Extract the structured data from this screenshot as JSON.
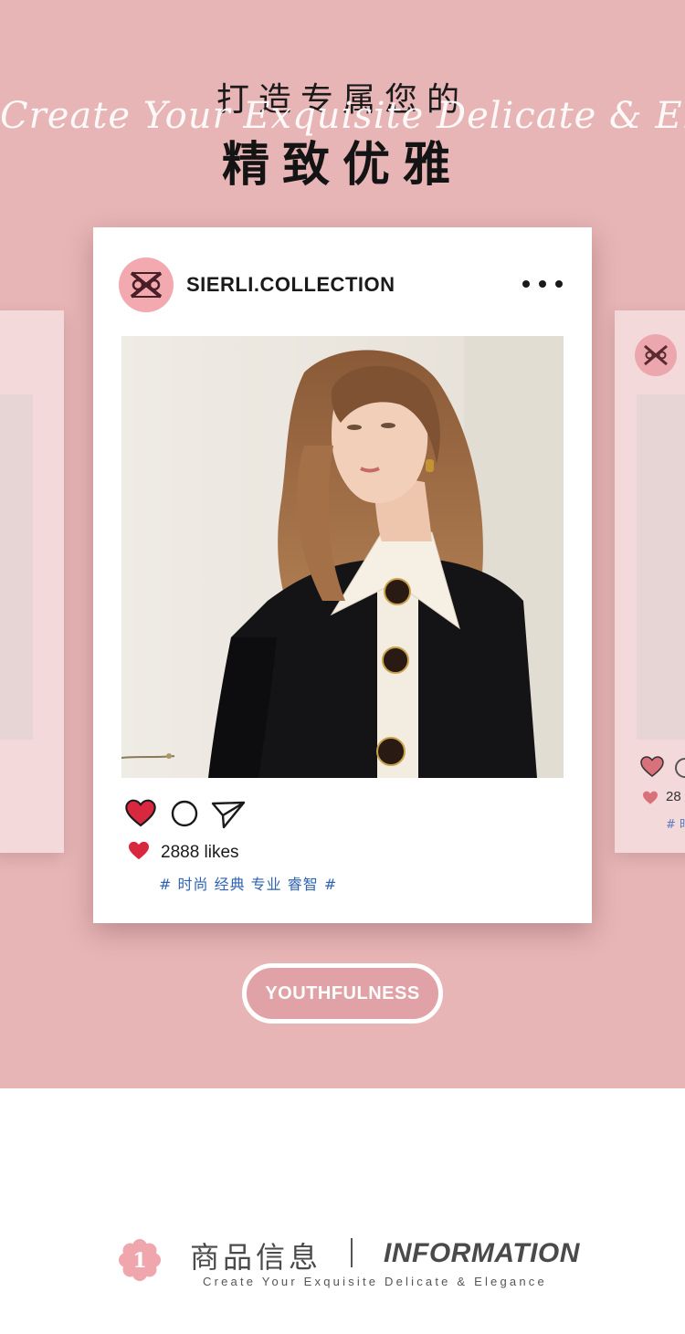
{
  "header": {
    "title_line1": "打造专属您的",
    "script_text": "Create Your Exquisite Delicate & Elegance",
    "title_line2": "精致优雅"
  },
  "post": {
    "handle": "SIERLI.COLLECTION",
    "avatar_icon": "brand-monogram-icon",
    "more_icon": "more-dots-icon",
    "actions": [
      "heart-icon",
      "comment-icon",
      "share-icon"
    ],
    "likes_text": "2888 likes",
    "tags": "# 时尚 经典 专业 睿智 #"
  },
  "ghost_card": {
    "likes_text": "28",
    "tag_text": "# 时"
  },
  "badge": {
    "label": "YOUTHFULNESS"
  },
  "info": {
    "number": "1",
    "title_cn": "商品信息",
    "separator": "|",
    "title_en": "INFORMATION",
    "subtitle": "Create Your Exquisite Delicate & Elegance"
  },
  "colors": {
    "hero_bg": "#e8b5b6",
    "card_bg": "#ffffff",
    "heart_red": "#d8283f",
    "tag_blue": "#2f63b3",
    "badge_pink": "#e0a2a6",
    "avatar_pink": "#f2a9b0"
  }
}
